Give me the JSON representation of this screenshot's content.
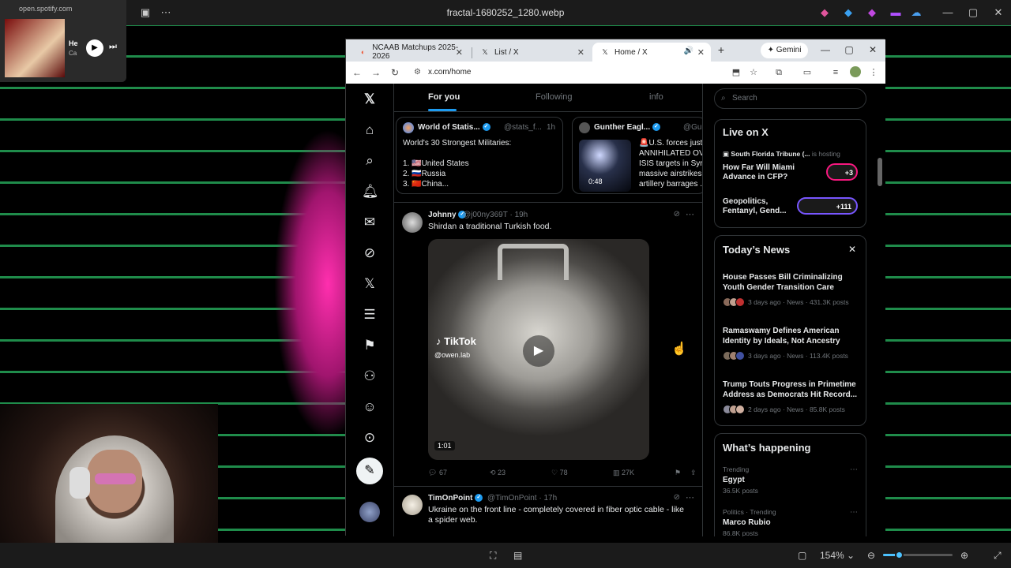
{
  "viewer": {
    "title": "fractal-1680252_1280.webp",
    "zoom": "154%"
  },
  "spotify": {
    "host": "open.spotify.com",
    "track": "He",
    "artist": "Ca"
  },
  "browser": {
    "tabs": [
      {
        "label": "NCAAB Matchups 2025-2026",
        "icon": "ncaa-icon"
      },
      {
        "label": "List / X",
        "icon": "x-logo-icon"
      },
      {
        "label": "Home / X",
        "icon": "x-logo-icon",
        "active": true
      }
    ],
    "gemini_label": "Gemini",
    "url": "x.com/home"
  },
  "timeline": {
    "tabs": [
      "For you",
      "Following",
      "info"
    ],
    "cards": [
      {
        "name": "World of Statis...",
        "handle": "@stats_f...",
        "time": "1h",
        "lines": [
          "World's 30 Strongest Militaries:",
          "1. 🇺🇸United States",
          "2. 🇷🇺Russia",
          "3. 🇨🇳China..."
        ]
      },
      {
        "name": "Gunther Eagl...",
        "handle": "@GuntherE",
        "lines": [
          "🚨U.S. forces just",
          "ANNIHILATED OVE",
          "ISIS targets in Syri",
          "massive airstrikes",
          "artillery barrages ..."
        ],
        "video_duration": "0:48"
      }
    ],
    "tweets": [
      {
        "name": "Johnny",
        "handle": "@j00ny369T",
        "time": "19h",
        "text": "Shirdan a traditional Turkish food.",
        "media": {
          "watermark": "TikTok",
          "watermark_handle": "@owen.lab",
          "duration": "1:01"
        },
        "replies": "67",
        "reposts": "23",
        "likes": "78",
        "views": "27K"
      },
      {
        "name": "TimOnPoint",
        "handle": "@TimOnPoint",
        "time": "17h",
        "text": "Ukraine on the front line - completely covered in fiber optic cable - like a spider web."
      }
    ]
  },
  "sidebar": {
    "search_placeholder": "Search",
    "live": {
      "title": "Live on X",
      "host": "South Florida Tribune (...",
      "host_status": "is hosting",
      "items": [
        {
          "title": "How Far Will Miami Advance in CFP?",
          "count": "+3"
        },
        {
          "title": "Geopolitics, Fentanyl, Gend...",
          "count": "+111"
        }
      ]
    },
    "news": {
      "title": "Today’s News",
      "items": [
        {
          "title": "House Passes Bill Criminalizing Youth Gender Transition Care",
          "meta": "3 days ago · News · 431.3K posts"
        },
        {
          "title": "Ramaswamy Defines American Identity by Ideals, Not Ancestry",
          "meta": "3 days ago · News · 113.4K posts"
        },
        {
          "title": "Trump Touts Progress in Primetime Address as Democrats Hit Record...",
          "meta": "2 days ago · News · 85.8K posts"
        }
      ]
    },
    "happening": {
      "title": "What’s happening",
      "items": [
        {
          "category": "Trending",
          "name": "Egypt",
          "count": "36.5K posts"
        },
        {
          "category": "Politics · Trending",
          "name": "Marco Rubio",
          "count": "86.8K posts"
        }
      ]
    }
  }
}
